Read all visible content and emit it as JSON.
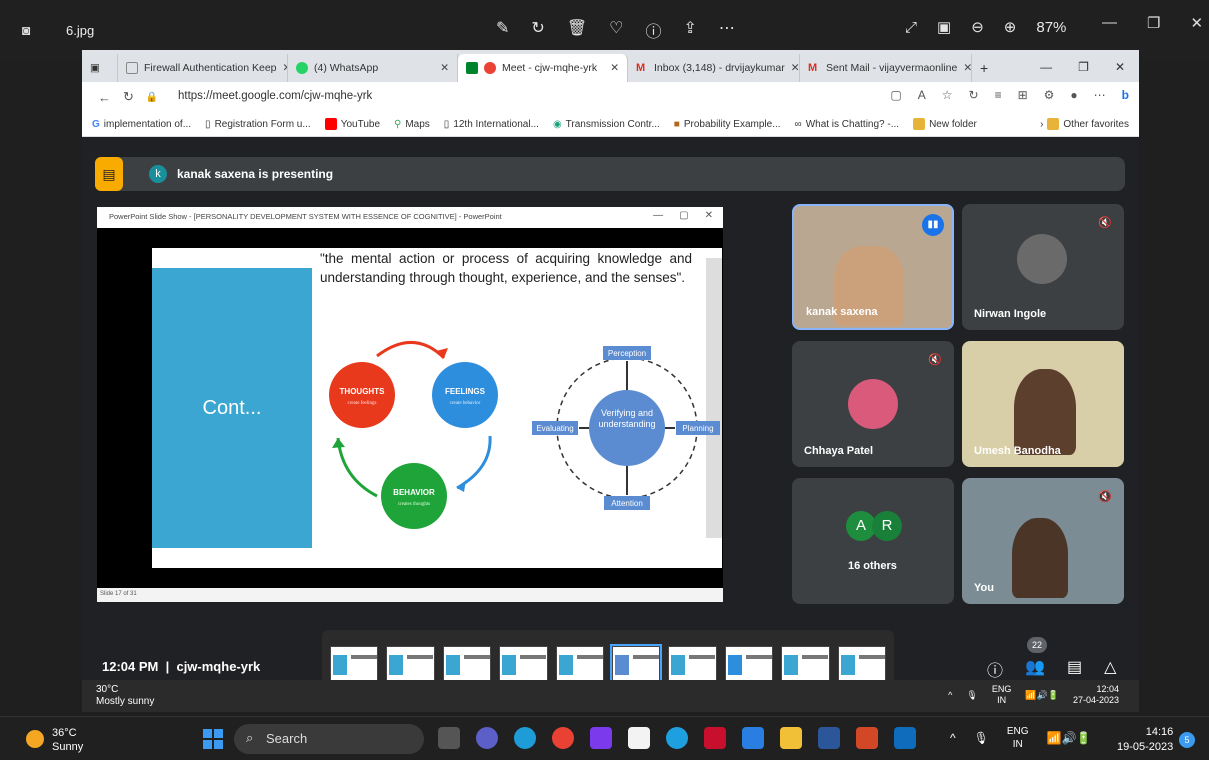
{
  "viewer": {
    "file_name": "6.jpg",
    "zoom": "87%"
  },
  "browser": {
    "tabs": [
      {
        "label": "Firewall Authentication Keep",
        "color": "#8a8a8a"
      },
      {
        "label": "(4) WhatsApp",
        "color": "#25d366"
      },
      {
        "label": "Meet - cjw-mqhe-yrk",
        "color": "#ea4335"
      },
      {
        "label": "Inbox (3,148) - drvijaykumar",
        "color": "#d93025"
      },
      {
        "label": "Sent Mail - vijayvermaonline",
        "color": "#d93025"
      }
    ],
    "url": "https://meet.google.com/cjw-mqhe-yrk",
    "bookmarks": [
      "implementation of...",
      "Registration Form u...",
      "YouTube",
      "Maps",
      "12th International...",
      "Transmission Contr...",
      "Probability Example...",
      "What is Chatting? -...",
      "New folder",
      "Other favorites"
    ]
  },
  "meet": {
    "presenter_initial": "k",
    "presenting_text": "kanak saxena is presenting",
    "slideshow_title": "PowerPoint Slide Show - [PERSONALITY DEVELOPMENT SYSTEM WITH ESSENCE OF COGNITIVE] - PowerPoint",
    "slide": {
      "cont": "Cont...",
      "quote": "\"the mental action or process of acquiring knowledge and understanding through thought, experience, and the senses\".",
      "cycle": {
        "thoughts": "THOUGHTS",
        "thoughts_sub": "create feelings",
        "feelings": "FEELINGS",
        "feelings_sub": "create behavior",
        "behavior": "BEHAVIOR",
        "behavior_sub": "creates thoughts"
      },
      "ring": {
        "center": "Verifying and understanding",
        "top": "Perception",
        "left": "Evaluating",
        "right": "Planning",
        "bottom": "Attention"
      },
      "status": "Slide 17 of 31"
    },
    "participants": [
      {
        "name": "kanak saxena"
      },
      {
        "name": "Nirwan Ingole"
      },
      {
        "name": "Chhaya Patel"
      },
      {
        "name": "Umesh Banodha"
      },
      {
        "name": "16 others"
      },
      {
        "name": "You"
      }
    ],
    "others_initials": [
      "A",
      "R"
    ],
    "participant_count": "22",
    "time": "12:04 PM",
    "meeting_code": "cjw-mqhe-yrk"
  },
  "inner_taskbar": {
    "temp": "30°C",
    "weather": "Mostly sunny",
    "lang": "ENG",
    "region": "IN",
    "time": "12:04",
    "date": "27-04-2023"
  },
  "taskbar": {
    "temp": "36°C",
    "weather": "Sunny",
    "search": "Search",
    "lang": "ENG",
    "region": "IN",
    "time": "14:16",
    "date": "19-05-2023",
    "notifications": "5"
  }
}
